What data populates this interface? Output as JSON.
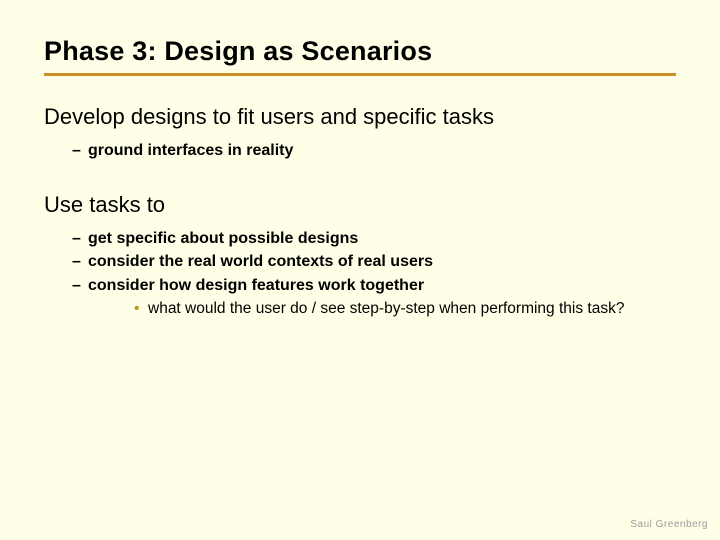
{
  "title": "Phase 3: Design as Scenarios",
  "sections": [
    {
      "head": "Develop designs to fit users and specific tasks",
      "bullets": [
        {
          "text": "ground interfaces in reality",
          "sub": []
        }
      ]
    },
    {
      "head": "Use tasks to",
      "bullets": [
        {
          "text": "get specific about possible designs",
          "sub": []
        },
        {
          "text": "consider the real world contexts of real users",
          "sub": []
        },
        {
          "text": "consider how design features work together",
          "sub": [
            "what would the user do / see step-by-step when performing this task?"
          ]
        }
      ]
    }
  ],
  "footer": "Saul Greenberg"
}
